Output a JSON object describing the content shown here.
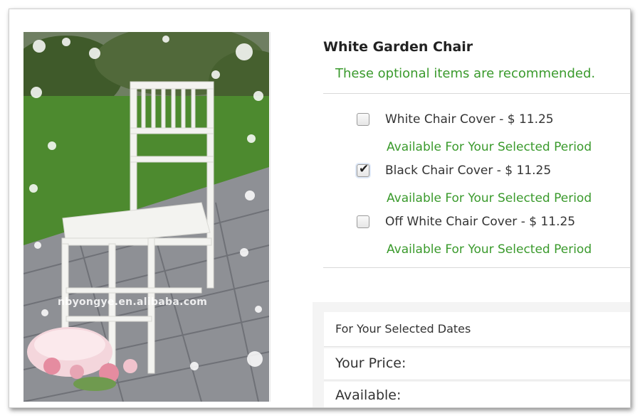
{
  "product": {
    "title": "White Garden Chair",
    "recommendation_note": "These optional items are recommended.",
    "image_watermark": "nbyongye.en.alibaba.com"
  },
  "options": [
    {
      "label": "White Chair Cover - $ 11.25",
      "checked": false,
      "availability": "Available For Your Selected Period"
    },
    {
      "label": "Black Chair Cover - $ 11.25",
      "checked": true,
      "availability": "Available For Your Selected Period"
    },
    {
      "label": "Off White Chair Cover - $ 11.25",
      "checked": false,
      "availability": "Available For Your Selected Period"
    }
  ],
  "dates_panel": {
    "header": "For Your Selected Dates",
    "price_label": "Your Price:",
    "available_label": "Available:"
  },
  "colors": {
    "accent_green": "#3a9a2c"
  }
}
